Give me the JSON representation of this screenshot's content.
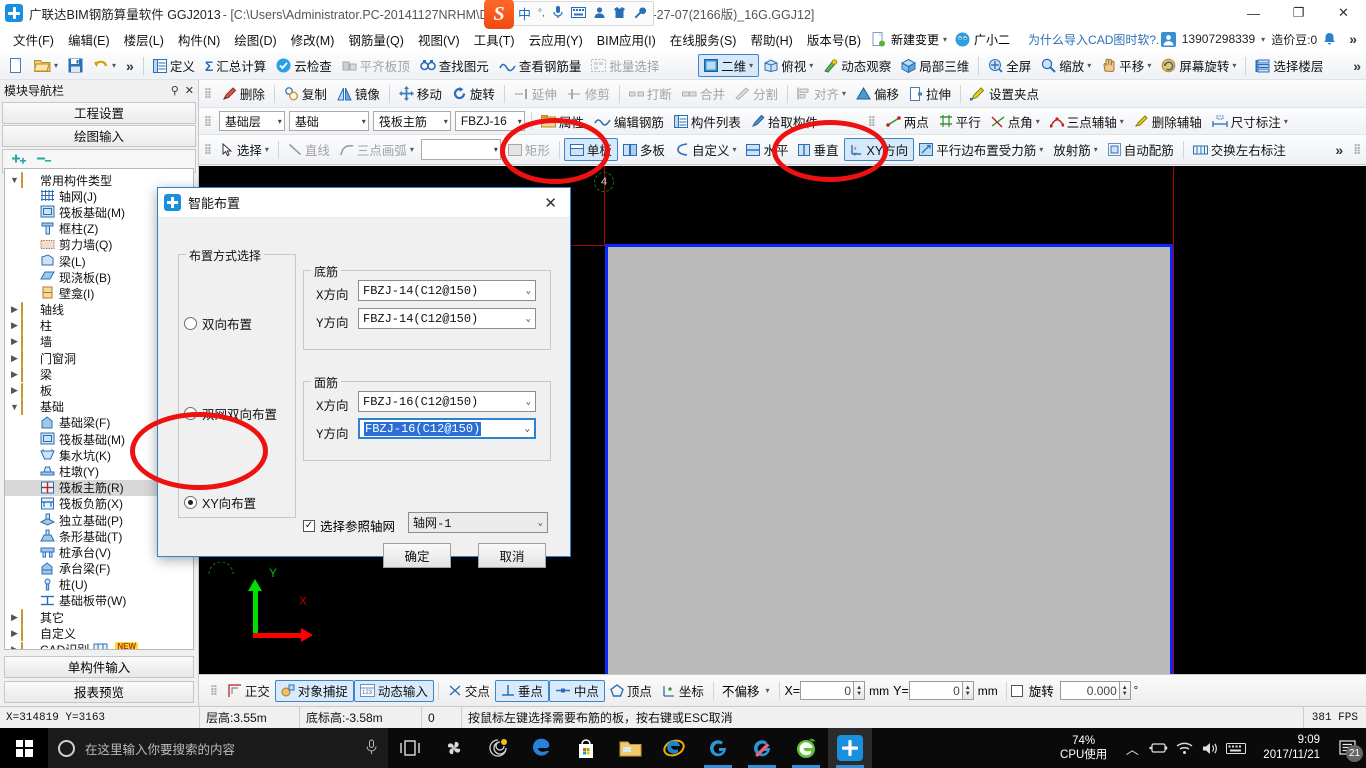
{
  "titlebar": {
    "app_name": "广联达BIM钢筋算量软件 GGJ2013",
    "doc_path": "- [C:\\Users\\Administrator.PC-20141127NRHM\\Desktop\\白龙村-2016-08-25-13-27-07(2166版)_16G.GGJ12]",
    "minimize": "—",
    "maximize": "❐",
    "close": "✕",
    "app_icon": "gld-plus-icon"
  },
  "ime": {
    "logo": "S",
    "items": [
      "中",
      "°,",
      "mic-icon",
      "keyboard-icon",
      "user-icon",
      "shirt-icon",
      "wrench-icon"
    ]
  },
  "menu": {
    "items": [
      "文件(F)",
      "编辑(E)",
      "楼层(L)",
      "构件(N)",
      "绘图(D)",
      "修改(M)",
      "钢筋量(Q)",
      "视图(V)",
      "工具(T)",
      "云应用(Y)",
      "BIM应用(I)",
      "在线服务(S)",
      "帮助(H)",
      "版本号(B)"
    ],
    "new_change": "新建变更",
    "assistant": "广小二",
    "ad_text": "为什么导入CAD图时软?.",
    "phone": "13907298339",
    "beans": "造价豆:0",
    "overflow": "»"
  },
  "toolbar1": {
    "items": [
      {
        "label": "",
        "icon": "new-file-icon",
        "dim": false
      },
      {
        "label": "",
        "icon": "open-folder-icon",
        "dim": false
      },
      {
        "label": "",
        "icon": "save-icon",
        "dim": false
      },
      {
        "label": "",
        "icon": "undo-icon",
        "dim": false
      }
    ],
    "overflow": "»",
    "buttons": [
      {
        "label": "定义",
        "icon": "define-icon",
        "dim": false
      },
      {
        "label": "汇总计算",
        "icon": "sigma-icon",
        "dim": false
      },
      {
        "label": "云检查",
        "icon": "cloud-check-icon",
        "dim": false
      },
      {
        "label": "平齐板顶",
        "icon": "align-slab-top-icon",
        "dim": true
      },
      {
        "label": "查找图元",
        "icon": "binoculars-icon",
        "dim": false
      },
      {
        "label": "查看钢筋量",
        "icon": "view-rebar-icon",
        "dim": false
      },
      {
        "label": "批量选择",
        "icon": "batch-select-icon",
        "dim": true
      }
    ],
    "right_buttons": [
      {
        "label": "二维",
        "icon": "2d-icon",
        "dim": false,
        "split": true
      },
      {
        "label": "俯视",
        "icon": "topview-icon",
        "dim": false,
        "split": true
      },
      {
        "label": "动态观察",
        "icon": "orbit-icon",
        "dim": false
      },
      {
        "label": "局部三维",
        "icon": "local-3d-icon",
        "dim": false
      },
      {
        "label": "全屏",
        "icon": "fullscreen-icon",
        "dim": false
      },
      {
        "label": "缩放",
        "icon": "zoom-icon",
        "dim": false,
        "split": true
      },
      {
        "label": "平移",
        "icon": "pan-icon",
        "dim": false,
        "split": true
      },
      {
        "label": "屏幕旋转",
        "icon": "screen-rotate-icon",
        "dim": false,
        "split": true
      },
      {
        "label": "选择楼层",
        "icon": "select-floor-icon",
        "dim": false
      }
    ]
  },
  "toolbar2": {
    "buttons": [
      {
        "label": "删除",
        "icon": "delete-icon",
        "dim": false
      },
      {
        "label": "复制",
        "icon": "copy-icon",
        "dim": false
      },
      {
        "label": "镜像",
        "icon": "mirror-icon",
        "dim": false
      },
      {
        "label": "移动",
        "icon": "move-icon",
        "dim": false
      },
      {
        "label": "旋转",
        "icon": "rotate-icon",
        "dim": false
      },
      {
        "label": "延伸",
        "icon": "extend-icon",
        "dim": true
      },
      {
        "label": "修剪",
        "icon": "trim-icon",
        "dim": true
      },
      {
        "label": "打断",
        "icon": "break-icon",
        "dim": true
      },
      {
        "label": "合并",
        "icon": "merge-icon",
        "dim": true
      },
      {
        "label": "分割",
        "icon": "split-icon",
        "dim": true
      },
      {
        "label": "对齐",
        "icon": "align-icon",
        "dim": true,
        "split": true
      },
      {
        "label": "偏移",
        "icon": "offset-icon",
        "dim": false
      },
      {
        "label": "拉伸",
        "icon": "stretch-icon",
        "dim": false
      },
      {
        "label": "设置夹点",
        "icon": "set-grip-icon",
        "dim": false
      }
    ]
  },
  "toolbar3": {
    "floor_combo": "基础层",
    "category_combo": "基础",
    "member_combo": "筏板主筋",
    "instance_combo": "FBZJ-16",
    "buttons": [
      {
        "label": "属性",
        "icon": "properties-icon",
        "dim": false
      },
      {
        "label": "编辑钢筋",
        "icon": "edit-rebar-icon",
        "dim": false
      },
      {
        "label": "构件列表",
        "icon": "member-list-icon",
        "dim": false
      },
      {
        "label": "拾取构件",
        "icon": "pick-member-icon",
        "dim": false
      }
    ],
    "aux_buttons": [
      {
        "label": "两点",
        "icon": "two-point-icon",
        "dim": false
      },
      {
        "label": "平行",
        "icon": "parallel-icon",
        "dim": false
      },
      {
        "label": "点角",
        "icon": "point-angle-icon",
        "dim": false,
        "split": true
      },
      {
        "label": "三点辅轴",
        "icon": "three-point-axis-icon",
        "dim": false,
        "split": true
      },
      {
        "label": "删除辅轴",
        "icon": "delete-axis-icon",
        "dim": false
      },
      {
        "label": "尺寸标注",
        "icon": "dimension-icon",
        "dim": false,
        "split": true
      }
    ]
  },
  "toolbar4": {
    "select_label": "选择",
    "buttons": [
      {
        "label": "直线",
        "icon": "line-icon",
        "dim": true
      },
      {
        "label": "三点画弧",
        "icon": "three-point-arc-icon",
        "dim": true,
        "split": true
      }
    ],
    "empty_combo": "",
    "shape_buttons": [
      {
        "label": "矩形",
        "icon": "rectangle-icon",
        "dim": true,
        "active": false
      },
      {
        "label": "单板",
        "icon": "single-slab-icon",
        "dim": false,
        "active": true
      },
      {
        "label": "多板",
        "icon": "multi-slab-icon",
        "dim": false,
        "active": false
      },
      {
        "label": "自定义",
        "icon": "custom-icon",
        "dim": false,
        "active": false,
        "split": true
      },
      {
        "label": "水平",
        "icon": "horizontal-icon",
        "dim": false,
        "active": false
      },
      {
        "label": "垂直",
        "icon": "vertical-icon",
        "dim": false,
        "active": false
      },
      {
        "label": "XY方向",
        "icon": "xy-direction-icon",
        "dim": false,
        "active": true
      },
      {
        "label": "平行边布置受力筋",
        "icon": "parallel-edge-rebar-icon",
        "dim": false,
        "active": false,
        "split": true
      },
      {
        "label": "放射筋",
        "icon": "radial-rebar-icon",
        "dim": false,
        "active": false,
        "split": true
      },
      {
        "label": "自动配筋",
        "icon": "auto-rebar-icon",
        "dim": false,
        "active": false
      },
      {
        "label": "交换左右标注",
        "icon": "swap-annotation-icon",
        "dim": false,
        "active": false
      }
    ],
    "overflow": "»"
  },
  "left_panel": {
    "title": "模块导航栏",
    "pin": "⇕",
    "close": "✕",
    "tabs": [
      "工程设置",
      "绘图输入"
    ],
    "tools": [
      "expand-all-icon",
      "collapse-all-icon"
    ],
    "footer_buttons": [
      "单构件输入",
      "报表预览"
    ],
    "tree": [
      {
        "indent": 0,
        "twisty": "▼",
        "icon": "folder-open-icon",
        "label": "常用构件类型",
        "selected": false
      },
      {
        "indent": 1,
        "twisty": "",
        "icon": "grid-axis-icon",
        "label": "轴网(J)",
        "selected": false
      },
      {
        "indent": 1,
        "twisty": "",
        "icon": "raft-foundation-icon",
        "label": "筏板基础(M)",
        "selected": false
      },
      {
        "indent": 1,
        "twisty": "",
        "icon": "frame-column-icon",
        "label": "框柱(Z)",
        "selected": false
      },
      {
        "indent": 1,
        "twisty": "",
        "icon": "shear-wall-icon",
        "label": "剪力墙(Q)",
        "selected": false
      },
      {
        "indent": 1,
        "twisty": "",
        "icon": "beam-icon",
        "label": "梁(L)",
        "selected": false
      },
      {
        "indent": 1,
        "twisty": "",
        "icon": "cast-slab-icon",
        "label": "现浇板(B)",
        "selected": false
      },
      {
        "indent": 1,
        "twisty": "",
        "icon": "niche-icon",
        "label": "壁龛(I)",
        "selected": false
      },
      {
        "indent": 0,
        "twisty": "▶",
        "icon": "folder-icon",
        "label": "轴线",
        "selected": false
      },
      {
        "indent": 0,
        "twisty": "▶",
        "icon": "folder-icon",
        "label": "柱",
        "selected": false
      },
      {
        "indent": 0,
        "twisty": "▶",
        "icon": "folder-icon",
        "label": "墙",
        "selected": false
      },
      {
        "indent": 0,
        "twisty": "▶",
        "icon": "folder-icon",
        "label": "门窗洞",
        "selected": false
      },
      {
        "indent": 0,
        "twisty": "▶",
        "icon": "folder-icon",
        "label": "梁",
        "selected": false
      },
      {
        "indent": 0,
        "twisty": "▶",
        "icon": "folder-icon",
        "label": "板",
        "selected": false
      },
      {
        "indent": 0,
        "twisty": "▼",
        "icon": "folder-open-icon",
        "label": "基础",
        "selected": false
      },
      {
        "indent": 1,
        "twisty": "",
        "icon": "foundation-beam-icon",
        "label": "基础梁(F)",
        "selected": false
      },
      {
        "indent": 1,
        "twisty": "",
        "icon": "raft-foundation-icon",
        "label": "筏板基础(M)",
        "selected": false
      },
      {
        "indent": 1,
        "twisty": "",
        "icon": "sump-icon",
        "label": "集水坑(K)",
        "selected": false
      },
      {
        "indent": 1,
        "twisty": "",
        "icon": "column-cap-icon",
        "label": "柱墩(Y)",
        "selected": false
      },
      {
        "indent": 1,
        "twisty": "",
        "icon": "raft-main-rebar-icon",
        "label": "筏板主筋(R)",
        "selected": true
      },
      {
        "indent": 1,
        "twisty": "",
        "icon": "raft-negative-rebar-icon",
        "label": "筏板负筋(X)",
        "selected": false
      },
      {
        "indent": 1,
        "twisty": "",
        "icon": "isolated-foundation-icon",
        "label": "独立基础(P)",
        "selected": false
      },
      {
        "indent": 1,
        "twisty": "",
        "icon": "strip-foundation-icon",
        "label": "条形基础(T)",
        "selected": false
      },
      {
        "indent": 1,
        "twisty": "",
        "icon": "pile-cap-icon",
        "label": "桩承台(V)",
        "selected": false
      },
      {
        "indent": 1,
        "twisty": "",
        "icon": "cap-beam-icon",
        "label": "承台梁(F)",
        "selected": false
      },
      {
        "indent": 1,
        "twisty": "",
        "icon": "pile-icon",
        "label": "桩(U)",
        "selected": false
      },
      {
        "indent": 1,
        "twisty": "",
        "icon": "foundation-band-icon",
        "label": "基础板带(W)",
        "selected": false
      },
      {
        "indent": 0,
        "twisty": "▶",
        "icon": "folder-icon",
        "label": "其它",
        "selected": false
      },
      {
        "indent": 0,
        "twisty": "▶",
        "icon": "folder-icon",
        "label": "自定义",
        "selected": false
      },
      {
        "indent": 0,
        "twisty": "▶",
        "icon": "folder-icon",
        "label": "CAD识别",
        "selected": false,
        "badge": "NEW"
      }
    ]
  },
  "dialog": {
    "title": "智能布置",
    "close": "✕",
    "mode_group_title": "布置方式选择",
    "modes": [
      {
        "label": "双向布置",
        "checked": false
      },
      {
        "label": "双网双向布置",
        "checked": false
      },
      {
        "label": "XY向布置",
        "checked": true
      }
    ],
    "bottom_group": {
      "title": "底筋",
      "x_label": "X方向",
      "x_value": "FBZJ-14(C12@150)",
      "y_label": "Y方向",
      "y_value": "FBZJ-14(C12@150)"
    },
    "top_group": {
      "title": "面筋",
      "x_label": "X方向",
      "x_value": "FBZJ-16(C12@150)",
      "y_label": "Y方向",
      "y_value": "FBZJ-16(C12@150)"
    },
    "axis_checkbox": {
      "label": "选择参照轴网",
      "checked": true,
      "value": "轴网-1"
    },
    "ok": "确定",
    "cancel": "取消"
  },
  "canvas": {
    "grid_bubble_label": "4",
    "ucs_x": "X",
    "ucs_y": "Y",
    "slab_fill": "#b9b9b9",
    "slab_border": "#0b26ff",
    "axis_color": "#b00000"
  },
  "optionbar": {
    "toggles": [
      {
        "label": "正交",
        "icon": "ortho-icon",
        "on": false
      },
      {
        "label": "对象捕捉",
        "icon": "osnap-icon",
        "on": true
      },
      {
        "label": "动态输入",
        "icon": "dyn-input-icon",
        "on": true
      }
    ],
    "snaps": [
      {
        "label": "交点",
        "icon": "intersection-icon",
        "on": false
      },
      {
        "label": "垂点",
        "icon": "perpendicular-icon",
        "on": true
      },
      {
        "label": "中点",
        "icon": "midpoint-icon",
        "on": true
      },
      {
        "label": "顶点",
        "icon": "vertex-icon",
        "on": false
      },
      {
        "label": "坐标",
        "icon": "coordinate-icon",
        "on": false
      }
    ],
    "offset_mode": "不偏移",
    "x_label": "X=",
    "x_value": "0",
    "x_unit": "mm",
    "y_label": "Y=",
    "y_value": "0",
    "y_unit": "mm",
    "rotate_label": "旋转",
    "rotate_value": "0.000",
    "rotate_unit": "°",
    "rotate_checked": false
  },
  "statusbar": {
    "coords": "X=314819  Y=3163",
    "floor_height": "层高:3.55m",
    "base_elev": "底标高:-3.58m",
    "extra": "0",
    "hint": "按鼠标左键选择需要布筋的板，按右键或ESC取消",
    "fps": "381 FPS"
  },
  "taskbar": {
    "search_placeholder": "在这里输入你要搜索的内容",
    "icons": [
      "task-view-icon",
      "fan-icon",
      "spiral-notify-icon",
      "edge-icon",
      "microsoft-store-icon",
      "file-explorer-icon",
      "internet-explorer-icon",
      "browser-g-icon",
      "browser-g-red-icon",
      "browser-e-green-icon",
      "ggj-app-icon"
    ],
    "cpu_percent": "74%",
    "cpu_label": "CPU使用",
    "tray_icons": [
      "chevron-up-icon",
      "battery-icon",
      "wifi-icon",
      "volume-icon",
      "keyboard-icon"
    ],
    "time": "9:09",
    "date": "2017/11/21",
    "notification_count": "21"
  }
}
